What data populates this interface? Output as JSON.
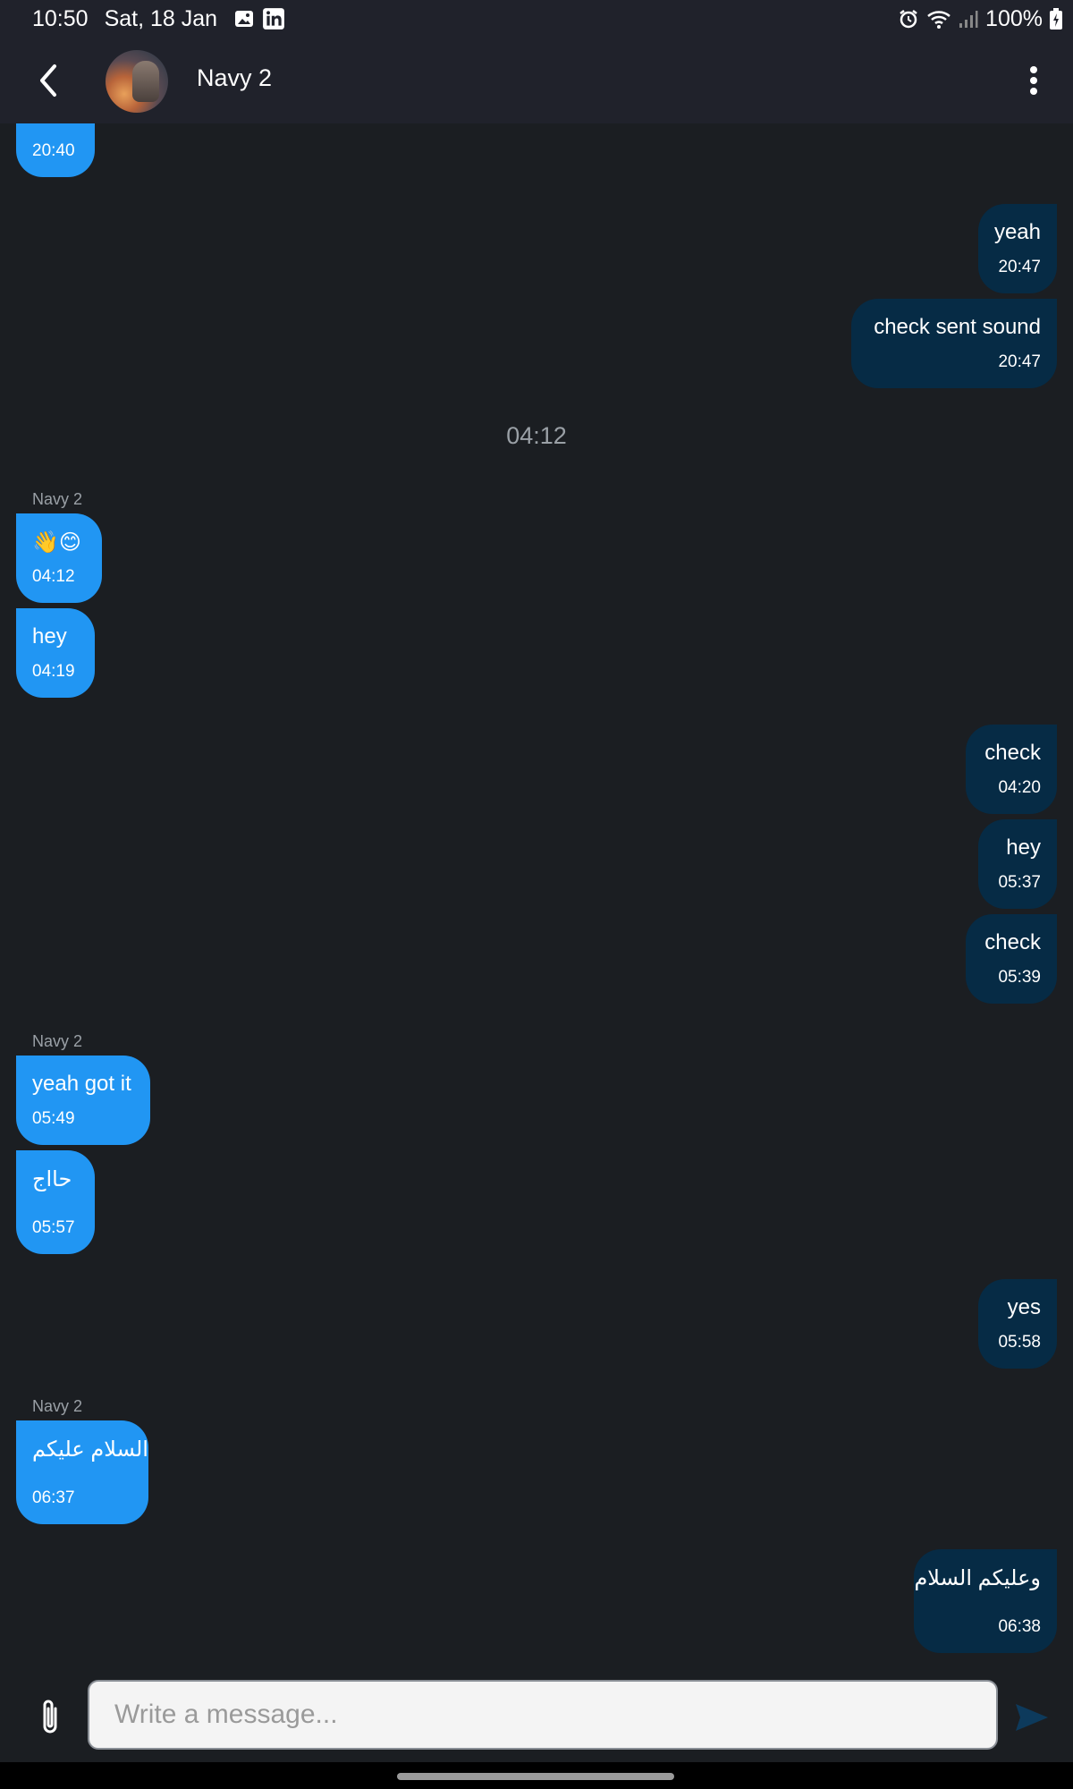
{
  "status_bar": {
    "time": "10:50",
    "date": "Sat, 18 Jan",
    "battery": "100%",
    "left_icons": [
      "image-icon",
      "linkedin-icon"
    ],
    "right_icons": [
      "alarm-icon",
      "wifi-icon",
      "signal-icon",
      "battery-icon"
    ]
  },
  "header": {
    "contact_name": "Navy 2",
    "back_icon": "chevron-left-icon",
    "menu_icon": "more-vert-icon"
  },
  "chat": {
    "time_divider": "04:12",
    "sender_label": "Navy 2",
    "messages": [
      {
        "direction": "in",
        "text": "",
        "time": "20:40"
      },
      {
        "direction": "out",
        "text": "yeah",
        "time": "20:47"
      },
      {
        "direction": "out",
        "text": "check sent sound",
        "time": "20:47"
      },
      {
        "direction": "in",
        "sender": "Navy 2",
        "text": "👋😊",
        "time": "04:12"
      },
      {
        "direction": "in",
        "text": "hey",
        "time": "04:19"
      },
      {
        "direction": "out",
        "text": "check",
        "time": "04:20"
      },
      {
        "direction": "out",
        "text": "hey",
        "time": "05:37"
      },
      {
        "direction": "out",
        "text": "check",
        "time": "05:39"
      },
      {
        "direction": "in",
        "sender": "Navy 2",
        "text": "yeah got it",
        "time": "05:49"
      },
      {
        "direction": "in",
        "text": "حااج",
        "time": "05:57"
      },
      {
        "direction": "out",
        "text": "yes",
        "time": "05:58"
      },
      {
        "direction": "in",
        "sender": "Navy 2",
        "text": "السلام عليكم",
        "time": "06:37"
      },
      {
        "direction": "out",
        "text": "وعليكم السلام",
        "time": "06:38"
      }
    ]
  },
  "composer": {
    "placeholder": "Write a message...",
    "attach_icon": "paperclip-icon",
    "send_icon": "send-icon"
  },
  "colors": {
    "background": "#1b1e22",
    "appbar": "#20222b",
    "incoming_bubble": "#2196f3",
    "outgoing_bubble": "#062b45",
    "send_icon": "#0d3a5c"
  }
}
